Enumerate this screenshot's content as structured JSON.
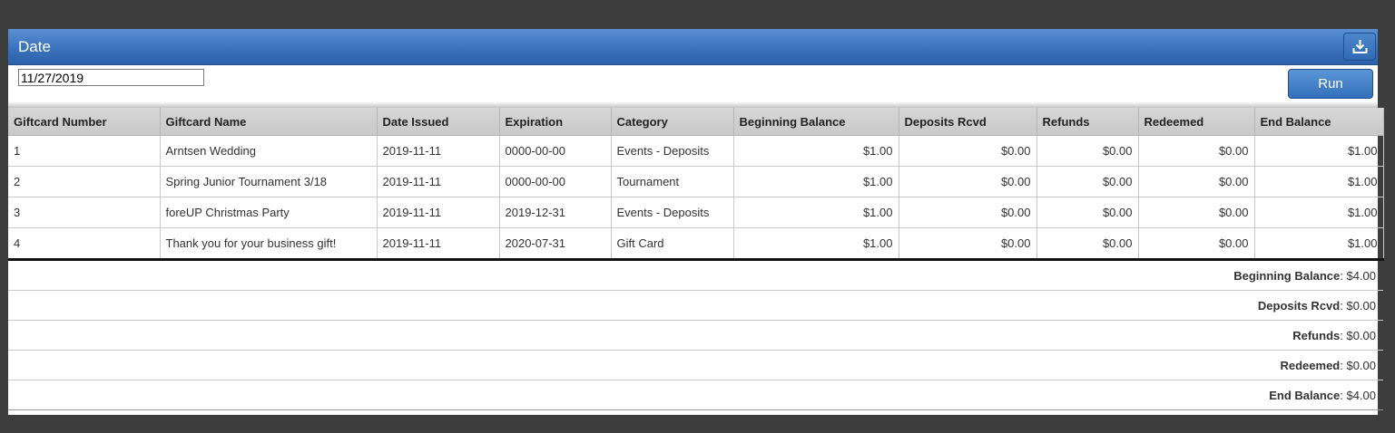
{
  "header": {
    "title": "Date",
    "export_icon": "download-icon"
  },
  "filters": {
    "date_value": "11/27/2019",
    "run_label": "Run"
  },
  "table": {
    "columns": [
      "Giftcard Number",
      "Giftcard Name",
      "Date Issued",
      "Expiration",
      "Category",
      "Beginning Balance",
      "Deposits Rcvd",
      "Refunds",
      "Redeemed",
      "End Balance"
    ],
    "rows": [
      [
        "1",
        "Arntsen Wedding",
        "2019-11-11",
        "0000-00-00",
        "Events - Deposits",
        "$1.00",
        "$0.00",
        "$0.00",
        "$0.00",
        "$1.00"
      ],
      [
        "2",
        "Spring Junior Tournament 3/18",
        "2019-11-11",
        "0000-00-00",
        "Tournament",
        "$1.00",
        "$0.00",
        "$0.00",
        "$0.00",
        "$1.00"
      ],
      [
        "3",
        "foreUP Christmas Party",
        "2019-11-11",
        "2019-12-31",
        "Events - Deposits",
        "$1.00",
        "$0.00",
        "$0.00",
        "$0.00",
        "$1.00"
      ],
      [
        "4",
        "Thank you for your business gift!",
        "2019-11-11",
        "2020-07-31",
        "Gift Card",
        "$1.00",
        "$0.00",
        "$0.00",
        "$0.00",
        "$1.00"
      ]
    ]
  },
  "totals": [
    {
      "label": "Beginning Balance",
      "value": ": $4.00"
    },
    {
      "label": "Deposits Rcvd",
      "value": ": $0.00"
    },
    {
      "label": "Refunds",
      "value": ": $0.00"
    },
    {
      "label": "Redeemed",
      "value": ": $0.00"
    },
    {
      "label": "End Balance",
      "value": ": $4.00"
    }
  ]
}
